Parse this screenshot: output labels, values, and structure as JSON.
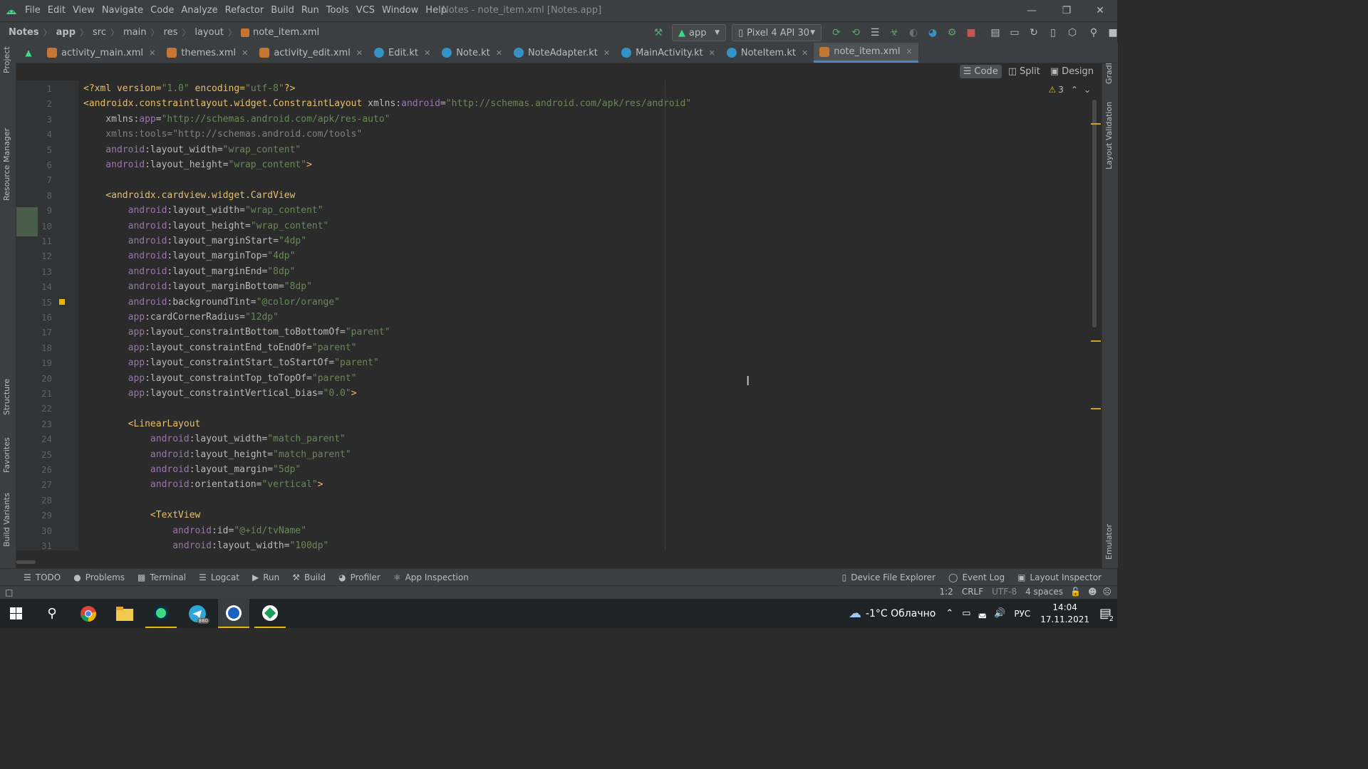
{
  "menu": {
    "items": [
      "File",
      "Edit",
      "View",
      "Navigate",
      "Code",
      "Analyze",
      "Refactor",
      "Build",
      "Run",
      "Tools",
      "VCS",
      "Window",
      "Help"
    ],
    "window_title": "Notes - note_item.xml [Notes.app]"
  },
  "breadcrumb": [
    "Notes",
    "app",
    "src",
    "main",
    "res",
    "layout",
    "note_item.xml"
  ],
  "run_config": "app",
  "device": "Pixel 4 API 30",
  "tabs": [
    {
      "label": "activity_main.xml",
      "kind": "xml"
    },
    {
      "label": "themes.xml",
      "kind": "xml"
    },
    {
      "label": "activity_edit.xml",
      "kind": "xml"
    },
    {
      "label": "Edit.kt",
      "kind": "kt"
    },
    {
      "label": "Note.kt",
      "kind": "kt"
    },
    {
      "label": "NoteAdapter.kt",
      "kind": "kt"
    },
    {
      "label": "MainActivity.kt",
      "kind": "kt"
    },
    {
      "label": "NoteItem.kt",
      "kind": "kt"
    },
    {
      "label": "note_item.xml",
      "kind": "xml",
      "active": true
    }
  ],
  "view_modes": {
    "code": "Code",
    "split": "Split",
    "design": "Design"
  },
  "warnings_count": "3",
  "left_tools": [
    "Project",
    "Resource Manager",
    "Structure",
    "Favorites",
    "Build Variants"
  ],
  "right_tools": [
    "Gradle",
    "Layout Validation",
    "Emulator"
  ],
  "code_lines": [
    [
      [
        "c-tag",
        "<?xml version="
      ],
      [
        "c-val",
        "\"1.0\""
      ],
      [
        "c-tag",
        " encoding="
      ],
      [
        "c-val",
        "\"utf-8\""
      ],
      [
        "c-tag",
        "?>"
      ]
    ],
    [
      [
        "c-tag",
        "<androidx.constraintlayout.widget.ConstraintLayout "
      ],
      [
        "c-attr",
        "xmlns:"
      ],
      [
        "c-ns",
        "android"
      ],
      [
        "c-attr",
        "="
      ],
      [
        "c-val",
        "\"http://schemas.android.com/apk/res/android\""
      ]
    ],
    [
      [
        "c-attr",
        "    xmlns:"
      ],
      [
        "c-ns",
        "app"
      ],
      [
        "c-attr",
        "="
      ],
      [
        "c-val",
        "\"http://schemas.android.com/apk/res-auto\""
      ]
    ],
    [
      [
        "c-dim",
        "    xmlns:tools=\"http://schemas.android.com/tools\""
      ]
    ],
    [
      [
        "c-ns",
        "    android"
      ],
      [
        "c-attr",
        ":layout_width="
      ],
      [
        "c-val",
        "\"wrap_content\""
      ]
    ],
    [
      [
        "c-ns",
        "    android"
      ],
      [
        "c-attr",
        ":layout_height="
      ],
      [
        "c-val",
        "\"wrap_content\""
      ],
      [
        "c-tag",
        ">"
      ]
    ],
    [
      [
        "c-attr",
        ""
      ]
    ],
    [
      [
        "c-tag",
        "    <androidx.cardview.widget.CardView"
      ]
    ],
    [
      [
        "c-ns",
        "        android"
      ],
      [
        "c-attr",
        ":layout_width="
      ],
      [
        "c-val",
        "\"wrap_content\""
      ]
    ],
    [
      [
        "c-ns",
        "        android"
      ],
      [
        "c-attr",
        ":layout_height="
      ],
      [
        "c-val",
        "\"wrap_content\""
      ]
    ],
    [
      [
        "c-ns",
        "        android"
      ],
      [
        "c-attr",
        ":layout_marginStart="
      ],
      [
        "c-val",
        "\"4dp\""
      ]
    ],
    [
      [
        "c-ns",
        "        android"
      ],
      [
        "c-attr",
        ":layout_marginTop="
      ],
      [
        "c-val",
        "\"4dp\""
      ]
    ],
    [
      [
        "c-ns",
        "        android"
      ],
      [
        "c-attr",
        ":layout_marginEnd="
      ],
      [
        "c-val",
        "\"8dp\""
      ]
    ],
    [
      [
        "c-ns",
        "        android"
      ],
      [
        "c-attr",
        ":layout_marginBottom="
      ],
      [
        "c-val",
        "\"8dp\""
      ]
    ],
    [
      [
        "c-ns",
        "        android"
      ],
      [
        "c-attr",
        ":backgroundTint="
      ],
      [
        "c-val",
        "\"@color/orange\""
      ]
    ],
    [
      [
        "c-ns",
        "        app"
      ],
      [
        "c-attr",
        ":cardCornerRadius="
      ],
      [
        "c-val",
        "\"12dp\""
      ]
    ],
    [
      [
        "c-ns",
        "        app"
      ],
      [
        "c-attr",
        ":layout_constraintBottom_toBottomOf="
      ],
      [
        "c-val",
        "\"parent\""
      ]
    ],
    [
      [
        "c-ns",
        "        app"
      ],
      [
        "c-attr",
        ":layout_constraintEnd_toEndOf="
      ],
      [
        "c-val",
        "\"parent\""
      ]
    ],
    [
      [
        "c-ns",
        "        app"
      ],
      [
        "c-attr",
        ":layout_constraintStart_toStartOf="
      ],
      [
        "c-val",
        "\"parent\""
      ]
    ],
    [
      [
        "c-ns",
        "        app"
      ],
      [
        "c-attr",
        ":layout_constraintTop_toTopOf="
      ],
      [
        "c-val",
        "\"parent\""
      ]
    ],
    [
      [
        "c-ns",
        "        app"
      ],
      [
        "c-attr",
        ":layout_constraintVertical_bias="
      ],
      [
        "c-val",
        "\"0.0\""
      ],
      [
        "c-tag",
        ">"
      ]
    ],
    [
      [
        "c-attr",
        ""
      ]
    ],
    [
      [
        "c-tag",
        "        <LinearLayout"
      ]
    ],
    [
      [
        "c-ns",
        "            android"
      ],
      [
        "c-attr",
        ":layout_width="
      ],
      [
        "c-val",
        "\"match_parent\""
      ]
    ],
    [
      [
        "c-ns",
        "            android"
      ],
      [
        "c-attr",
        ":layout_height="
      ],
      [
        "c-val",
        "\"match_parent\""
      ]
    ],
    [
      [
        "c-ns",
        "            android"
      ],
      [
        "c-attr",
        ":layout_margin="
      ],
      [
        "c-val",
        "\"5dp\""
      ]
    ],
    [
      [
        "c-ns",
        "            android"
      ],
      [
        "c-attr",
        ":orientation="
      ],
      [
        "c-val",
        "\"vertical\""
      ],
      [
        "c-tag",
        ">"
      ]
    ],
    [
      [
        "c-attr",
        ""
      ]
    ],
    [
      [
        "c-tag",
        "            <TextView"
      ]
    ],
    [
      [
        "c-ns",
        "                android"
      ],
      [
        "c-attr",
        ":id="
      ],
      [
        "c-val",
        "\"@+id/tvName\""
      ]
    ],
    [
      [
        "c-ns",
        "                android"
      ],
      [
        "c-attr",
        ":layout_width="
      ],
      [
        "c-val",
        "\"100dp\""
      ]
    ]
  ],
  "bottom_tools": [
    "TODO",
    "Problems",
    "Terminal",
    "Logcat",
    "Run",
    "Build",
    "Profiler",
    "App Inspection"
  ],
  "bottom_right_tools": [
    "Device File Explorer",
    "Event Log",
    "Layout Inspector"
  ],
  "status": {
    "position": "1:2",
    "line_sep": "CRLF",
    "encoding": "UTF-8",
    "indent": "4 spaces"
  },
  "taskbar": {
    "weather": "-1°C  Облачно",
    "lang": "РУС",
    "time": "14:04",
    "date": "17.11.2021",
    "notif_count": "2",
    "telegram_badge": "880"
  }
}
